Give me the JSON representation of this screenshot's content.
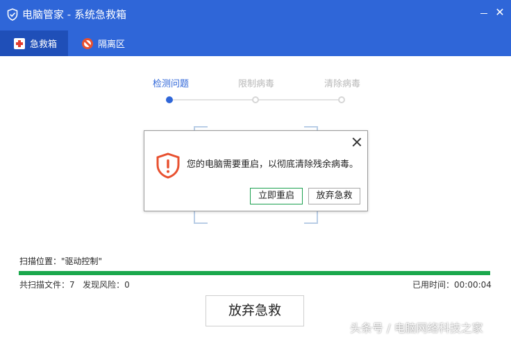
{
  "window": {
    "title": "电脑管家 - 系统急救箱",
    "icons": {
      "app": "shield-icon",
      "minimize": "minimize-icon",
      "close": "close-icon"
    },
    "colors": {
      "titlebar": "#2f66d8",
      "active_tab": "#1f4fb8",
      "accent_green": "#1aa84c",
      "warning": "#e8502f"
    }
  },
  "tabs": [
    {
      "label": "急救箱",
      "icon": "first-aid-kit-icon",
      "active": true
    },
    {
      "label": "隔离区",
      "icon": "ban-icon",
      "active": false
    }
  ],
  "steps": [
    {
      "label": "检测问题",
      "state": "current"
    },
    {
      "label": "限制病毒",
      "state": "pending"
    },
    {
      "label": "清除病毒",
      "state": "pending"
    }
  ],
  "dialog": {
    "message": "您的电脑需要重启，以彻底清除残余病毒。",
    "icon": "warning-shield-icon",
    "restart_label": "立即重启",
    "giveup_label": "放弃急救"
  },
  "scan": {
    "position_text": "扫描位置：\"驱动控制\"",
    "progress_percent": 100,
    "files_text": "共扫描文件：7",
    "risk_text": "发现风险：0",
    "elapsed_text": "已用时间：00:00:04"
  },
  "footer": {
    "giveup_label": "放弃急救"
  },
  "watermark": "头条号 / 电脑网络科技之家"
}
